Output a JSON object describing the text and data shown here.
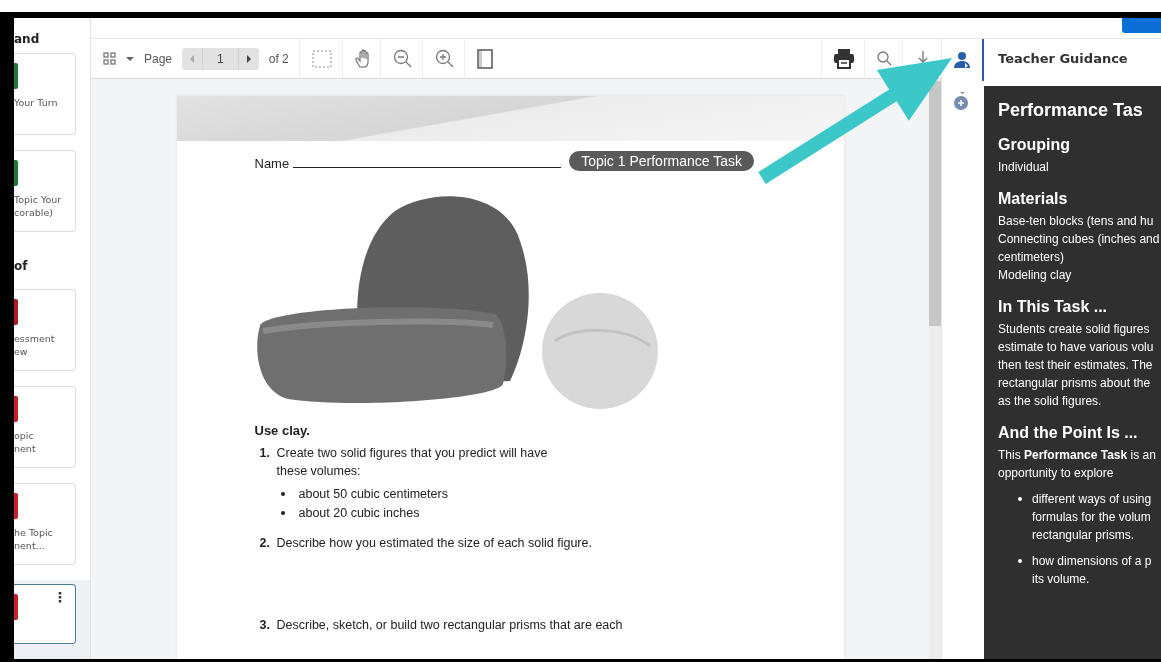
{
  "sidebar": {
    "items": [
      {
        "kind": "heading",
        "text": "and"
      },
      {
        "kind": "card",
        "color": "#1e7a2e",
        "lines": [
          "Your Turn"
        ],
        "selected": false
      },
      {
        "kind": "card",
        "color": "#1e7a2e",
        "lines": [
          "Topic Your",
          "corable)"
        ],
        "selected": false
      },
      {
        "kind": "heading",
        "text": "of"
      },
      {
        "kind": "card",
        "color": "#b01c24",
        "lines": [
          "essment",
          "ew"
        ],
        "selected": false
      },
      {
        "kind": "card",
        "color": "#c8202a",
        "lines": [
          "opic",
          "nent"
        ],
        "selected": false
      },
      {
        "kind": "card",
        "color": "#c8202a",
        "lines": [
          "he Topic",
          "nent..."
        ],
        "selected": false
      },
      {
        "kind": "card",
        "color": "#c8202a",
        "selected": true,
        "menu": "⋮"
      }
    ]
  },
  "toolbar": {
    "page_label": "Page",
    "page_value": "1",
    "page_total": "of 2"
  },
  "document": {
    "name_label": "Name",
    "title": "Topic 1 Performance Task",
    "intro": "Use clay.",
    "steps": [
      {
        "number": "1.",
        "lines": [
          "Create two solid figures that you predict will have",
          "these volumes:"
        ],
        "bullets": [
          "about 50 cubic centimeters",
          "about 20 cubic inches"
        ]
      },
      {
        "number": "2.",
        "lines": [
          "Describe how you estimated the size of each solid figure."
        ]
      },
      {
        "number": "3.",
        "lines": [
          "Describe, sketch, or build two rectangular prisms that are each"
        ]
      }
    ]
  },
  "side_tabs": [
    {
      "kind": "guidance",
      "selected": true
    },
    {
      "kind": "resources",
      "selected": false
    }
  ],
  "guidance": {
    "header": "Teacher Guidance",
    "title": "Performance Tas",
    "sections": [
      {
        "heading": "Grouping",
        "blocks": [
          {
            "kind": "text",
            "lines": [
              "Individual"
            ]
          }
        ]
      },
      {
        "heading": "Materials",
        "blocks": [
          {
            "kind": "text",
            "lines": [
              "Base-ten blocks (tens and hu",
              "Connecting cubes (inches and",
              "centimeters)",
              "Modeling clay"
            ]
          }
        ]
      },
      {
        "heading": "In This Task ...",
        "blocks": [
          {
            "kind": "text",
            "lines": [
              "Students create solid figures",
              "estimate to have various volu",
              "then test their estimates. The",
              "rectangular prisms about the",
              "as the solid figures."
            ]
          }
        ]
      },
      {
        "heading": "And the Point Is ...",
        "blocks": [
          {
            "kind": "text",
            "lines": [
              "This **Performance Task** is an",
              "opportunity to explore"
            ]
          },
          {
            "kind": "bullets",
            "items": [
              [
                "different ways of using",
                "formulas for the volum",
                "rectangular prisms."
              ],
              [
                "how dimensions of a p",
                "its volume."
              ]
            ]
          }
        ]
      }
    ]
  }
}
